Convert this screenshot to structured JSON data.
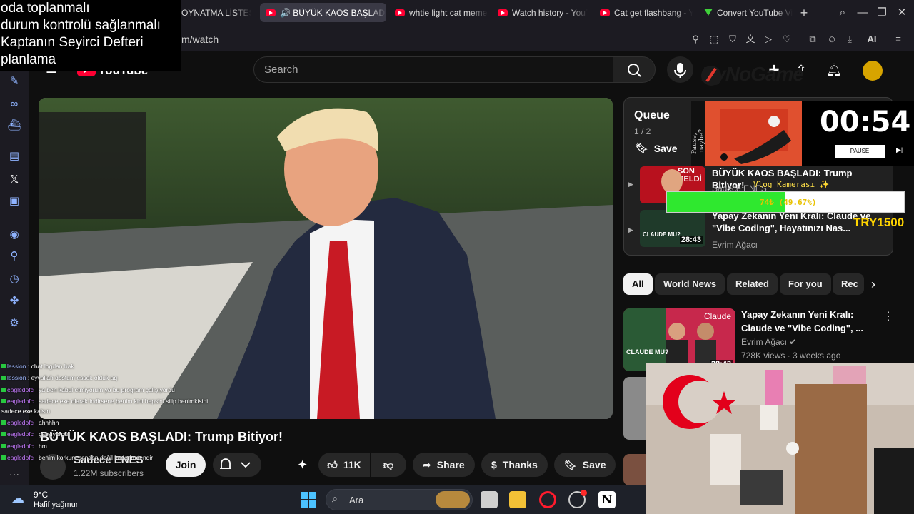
{
  "browser": {
    "tabs": [
      {
        "label": "OYNATMA LİSTESİ - OYNAYANLAR FİLM"
      },
      {
        "label": "🔊 BÜYÜK KAOS BAŞLADI: Trump Bitiyor!"
      },
      {
        "label": "whtie light cat meme - YouTube"
      },
      {
        "label": "Watch history - YouTube"
      },
      {
        "label": "Cat get flashbang - YouTube"
      },
      {
        "label": "Convert YouTube Videos"
      }
    ],
    "new_tab": "+",
    "url": "m/watch",
    "ai_label": "AI"
  },
  "notes_overlay": {
    "lines": [
      "oda toplanmalı",
      "durum kontrolü sağlanmalı",
      "Kaptanın Seyirci Defteri",
      "planlama"
    ]
  },
  "youtube": {
    "logo": "YouTube",
    "search_placeholder": "Search",
    "video_title": "BÜYÜK KAOS BAŞLADI: Trump Bitiyor!",
    "channel": "Sadece ENES",
    "subscribers": "1.22M subscribers",
    "join": "Join",
    "likes": "11K",
    "share": "Share",
    "thanks": "Thanks",
    "save": "Save"
  },
  "queue": {
    "title": "Queue",
    "count": "1 / 2",
    "save": "Save",
    "items": [
      {
        "title": "BÜYÜK KAOS BAŞLADI: Trump Bitiyor!",
        "channel": "Sadece ENES",
        "thumb_text": "SON GELDİ"
      },
      {
        "title": "Yapay Zekanın Yeni Kralı: Claude ve \"Vibe Coding\", Hayatınızı Nas...",
        "channel": "Evrim Ağacı",
        "duration": "28:43",
        "thumb_text": "CLAUDE MU?"
      }
    ]
  },
  "chips": [
    "All",
    "World News",
    "Related",
    "For you",
    "Rec"
  ],
  "recommendation": {
    "title": "Yapay Zekanın Yeni Kralı: Claude ve \"Vibe Coding\", ...",
    "channel": "Evrim Ağacı",
    "meta": "728K views · 3 weeks ago",
    "duration": "28:43",
    "thumb_text": "CLAUDE MU?",
    "thumb_label": "Claude"
  },
  "stream_overlay": {
    "brand": "ByNoGame",
    "timer": "00:54",
    "pause": "PAUSE",
    "promo_side": "Pause, maybe?",
    "vlog_label": "Vlog Kamerası ✨",
    "progress_text": "74₺ (49.67%)",
    "progress_fraction": 0.4967,
    "try_label": "TRY1500"
  },
  "chat": [
    {
      "user": "lession",
      "msg": ": chat logdan bak"
    },
    {
      "user": "lession",
      "msg": ": eyvallah dostum essek olduk aq"
    },
    {
      "user": "eagledofc",
      "msg": ": ya ben kabul etmiyorum ya bu program çalışıyordu"
    },
    {
      "user": "eagledofc",
      "msg": ": sadece exe olarak indirsene benim kini hepsini silip benimkisini"
    },
    {
      "user": "",
      "msg": "sadece exe kalsın"
    },
    {
      "user": "eagledofc",
      "msg": ": ahhhhh"
    },
    {
      "user": "eagledofc",
      "msg": ": çalışıyordu"
    },
    {
      "user": "eagledofc",
      "msg": ": hm"
    },
    {
      "user": "eagledofc",
      "msg": ": benim korkum senden değil kaderimdendir"
    }
  ],
  "taskbar": {
    "temp": "9°C",
    "weather": "Hafif yağmur",
    "search": "Ara"
  },
  "colors": {
    "youtube_red": "#ff0033",
    "progress_green": "#2fe82f",
    "timer_bg": "#000000"
  }
}
